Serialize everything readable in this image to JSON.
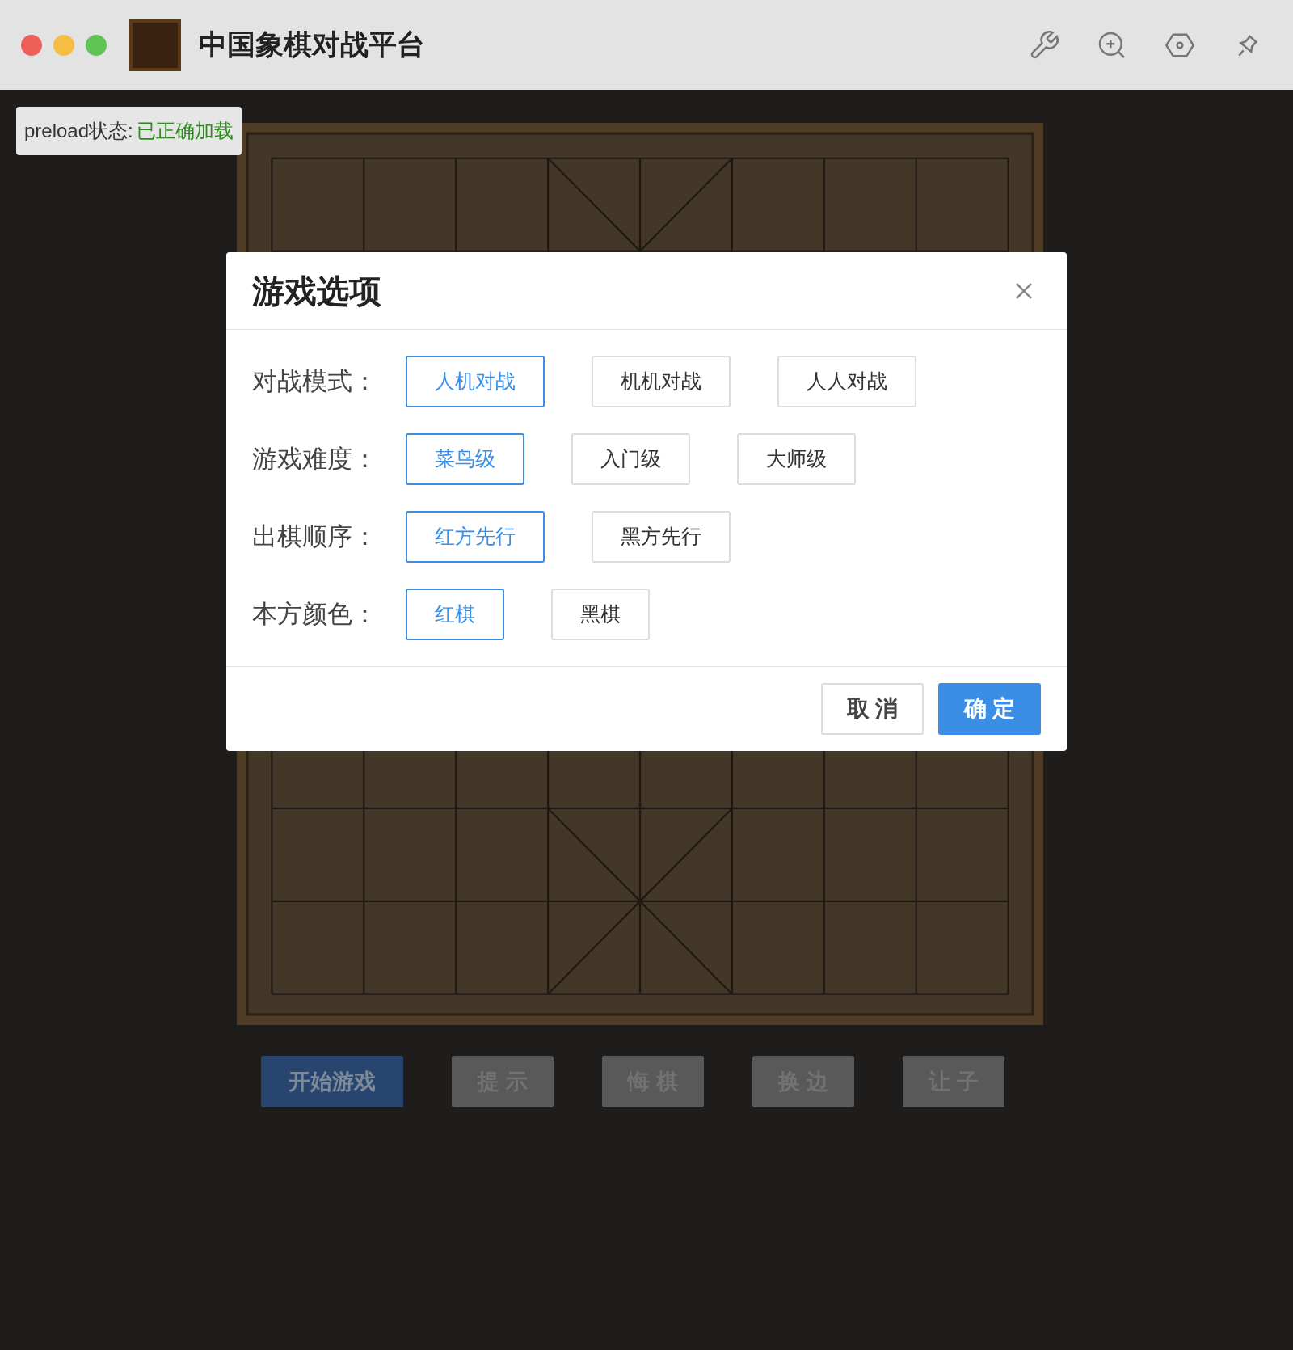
{
  "window": {
    "title": "中国象棋对战平台"
  },
  "preload": {
    "label": "preload状态:",
    "status": "已正确加载"
  },
  "dialog": {
    "title": "游戏选项",
    "options": [
      {
        "label": "对战模式：",
        "choices": [
          {
            "label": "人机对战",
            "selected": true
          },
          {
            "label": "机机对战",
            "selected": false
          },
          {
            "label": "人人对战",
            "selected": false
          }
        ]
      },
      {
        "label": "游戏难度：",
        "choices": [
          {
            "label": "菜鸟级",
            "selected": true
          },
          {
            "label": "入门级",
            "selected": false
          },
          {
            "label": "大师级",
            "selected": false
          }
        ]
      },
      {
        "label": "出棋顺序：",
        "choices": [
          {
            "label": "红方先行",
            "selected": true
          },
          {
            "label": "黑方先行",
            "selected": false
          }
        ]
      },
      {
        "label": "本方颜色：",
        "choices": [
          {
            "label": "红棋",
            "selected": true
          },
          {
            "label": "黑棋",
            "selected": false
          }
        ]
      }
    ],
    "buttons": [
      {
        "label": "取 消",
        "primary": false
      },
      {
        "label": "确 定",
        "primary": true
      }
    ]
  },
  "actions": [
    {
      "label": "开始游戏",
      "disabled": false
    },
    {
      "label": "提 示",
      "disabled": true
    },
    {
      "label": "悔 棋",
      "disabled": true
    },
    {
      "label": "换 边",
      "disabled": true
    },
    {
      "label": "让 子",
      "disabled": true
    }
  ]
}
